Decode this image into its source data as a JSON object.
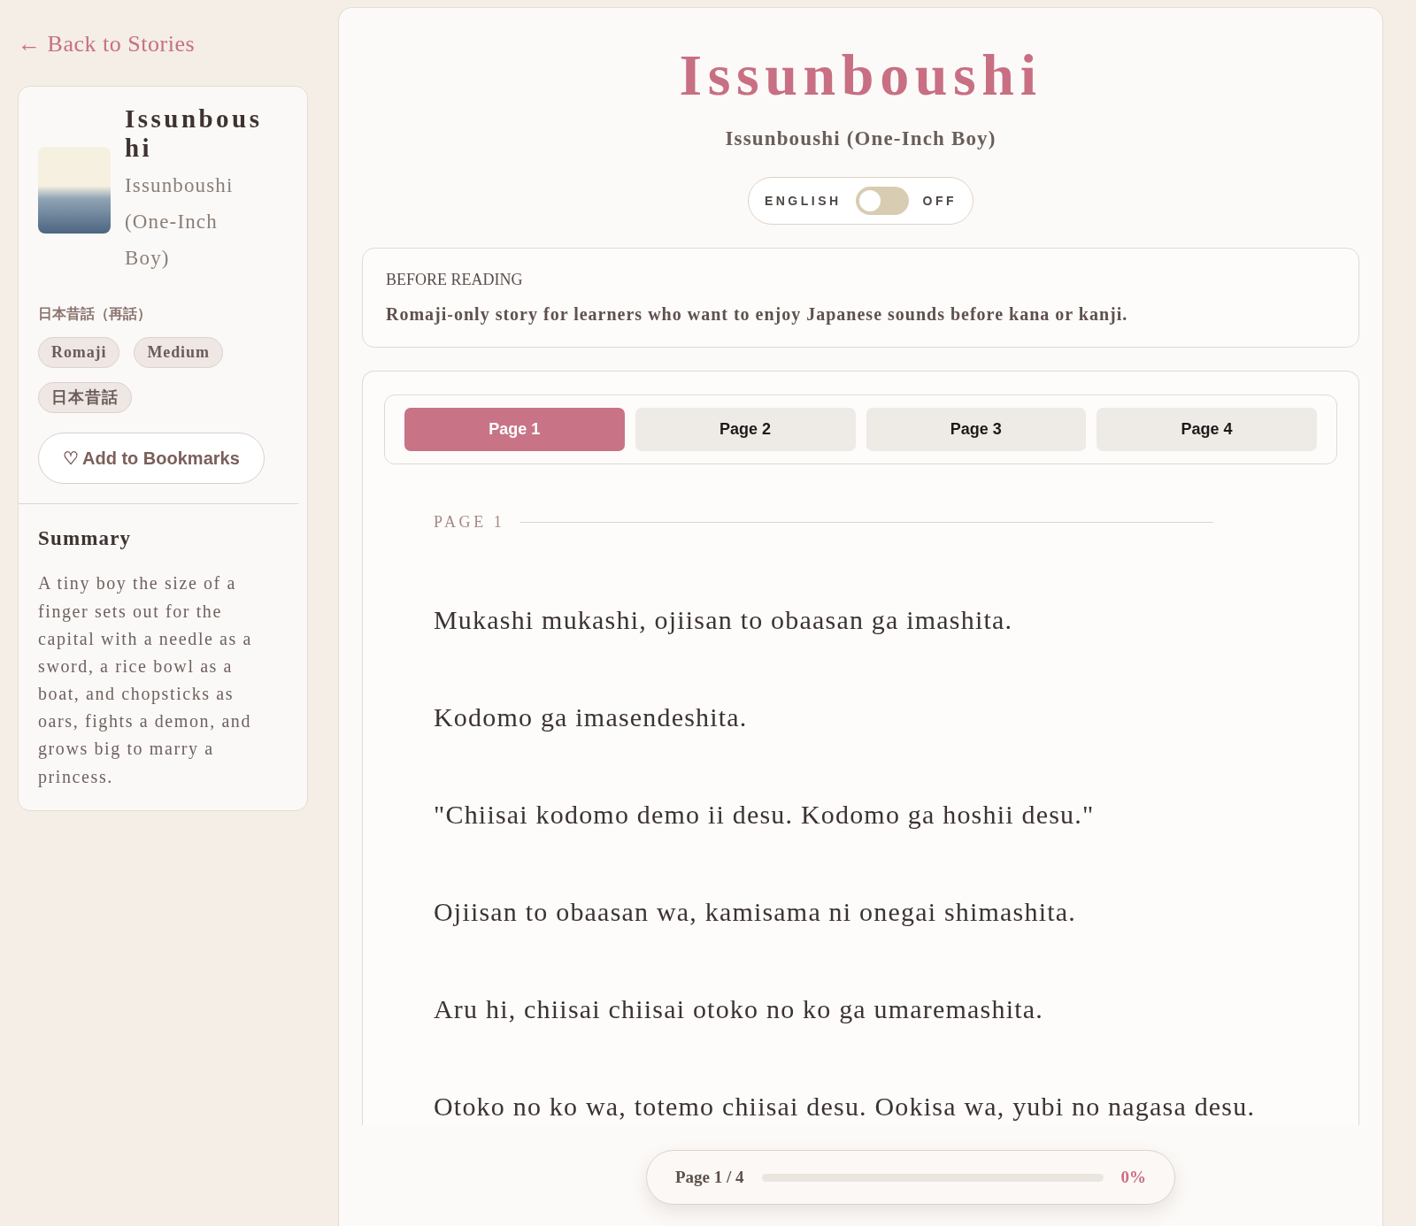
{
  "back_link": {
    "label": "← Back to Stories"
  },
  "sidebar": {
    "title": "Issunboushi",
    "subtitle": "Issunboushi (One-Inch Boy)",
    "category": "日本昔話（再話）",
    "tags": [
      "Romaji",
      "Medium",
      "日本昔話"
    ],
    "bookmark_button": {
      "icon": "♡",
      "label": "Add to Bookmarks"
    },
    "summary": {
      "heading": "Summary",
      "text": "A tiny boy the size of a finger sets out for the capital with a needle as a sword, a rice bowl as a boat, and chopsticks as oars, fights a demon, and grows big to marry a princess."
    }
  },
  "story": {
    "title": "Issunboushi",
    "subtitle": "Issunboushi (One-Inch Boy)",
    "english_toggle": {
      "label": "ENGLISH",
      "on": false,
      "state_text": "OFF"
    },
    "before_reading": {
      "heading": "BEFORE READING",
      "text": "Romaji-only story for learners who want to enjoy Japanese sounds before kana or kanji."
    },
    "tabs": [
      {
        "label": "Page 1",
        "selected": true
      },
      {
        "label": "Page 2",
        "selected": false
      },
      {
        "label": "Page 3",
        "selected": false
      },
      {
        "label": "Page 4",
        "selected": false
      }
    ],
    "page_label": "PAGE 1",
    "paragraphs": [
      "Mukashi mukashi, ojiisan to obaasan ga imashita.",
      "Kodomo ga imasendeshita.",
      "\"Chiisai kodomo demo ii desu. Kodomo ga hoshii desu.\"",
      "Ojiisan to obaasan wa, kamisama ni onegai shimashita.",
      "Aru hi, chiisai chiisai otoko no ko ga umaremashita.",
      "Otoko no ko wa, totemo chiisai desu. Ookisa wa, yubi no nagasa desu."
    ]
  },
  "progress": {
    "label": "Page 1 / 4",
    "level": 0,
    "percent": "0%"
  }
}
